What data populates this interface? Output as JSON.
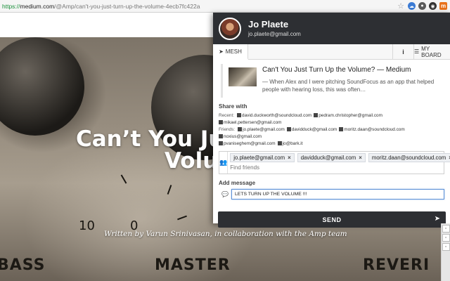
{
  "browser": {
    "url_scheme": "https://",
    "url_host": "medium.com",
    "url_path": "/@Amp/can't-you-just-turn-up-the-volume-4ecb7fc422a",
    "extension_icons": [
      "star-icon",
      "cloud-icon",
      "circle-icon",
      "ghost-icon",
      "orange-m-icon"
    ],
    "extension_m_label": "m"
  },
  "article": {
    "title_line1": "Can’t You Just",
    "title_line2": "Volum",
    "byline": "Written by Varun Srinivasan, in collaboration with the Amp team",
    "dial_number": "10",
    "dial_number_2": "0",
    "amp_label_left": "BASS",
    "amp_label_center": "MASTER",
    "amp_label_right": "REVERI"
  },
  "popup": {
    "user_name": "Jo Plaete",
    "user_email": "jo.plaete@gmail.com",
    "tabs": {
      "mesh": "MESH",
      "info": "i",
      "board": "MY BOARD"
    },
    "preview": {
      "title": "Can't You Just Turn Up the Volume? — Medium",
      "description": "— When Alex and I were pitching SoundFocus as an app that helped people with hearing loss, this was often…"
    },
    "share_with_label": "Share with",
    "recent_label": "Recent:",
    "recent": [
      "david.duckworth@soundcloud.com",
      "pedram.christopher@gmail.com",
      "mikael.pettersen@gmail.com"
    ],
    "friends_label": "Friends:",
    "friends": [
      "jo.plaete@gmail.com",
      "davidduck@gmail.com",
      "moritz.daan@soundcloud.com",
      "noxius@gmail.com",
      "pvaniseghem@gmail.com",
      "jo@bark.it"
    ],
    "recipients": [
      "jo.plaete@gmail.com",
      "davidduck@gmail.com",
      "moritz.daan@soundcloud.com"
    ],
    "chip_remove": "×",
    "find_placeholder": "Find friends",
    "add_message_label": "Add message",
    "message_value": "LETS TURN UP THE VOLUME !!!",
    "send_label": "SEND"
  }
}
